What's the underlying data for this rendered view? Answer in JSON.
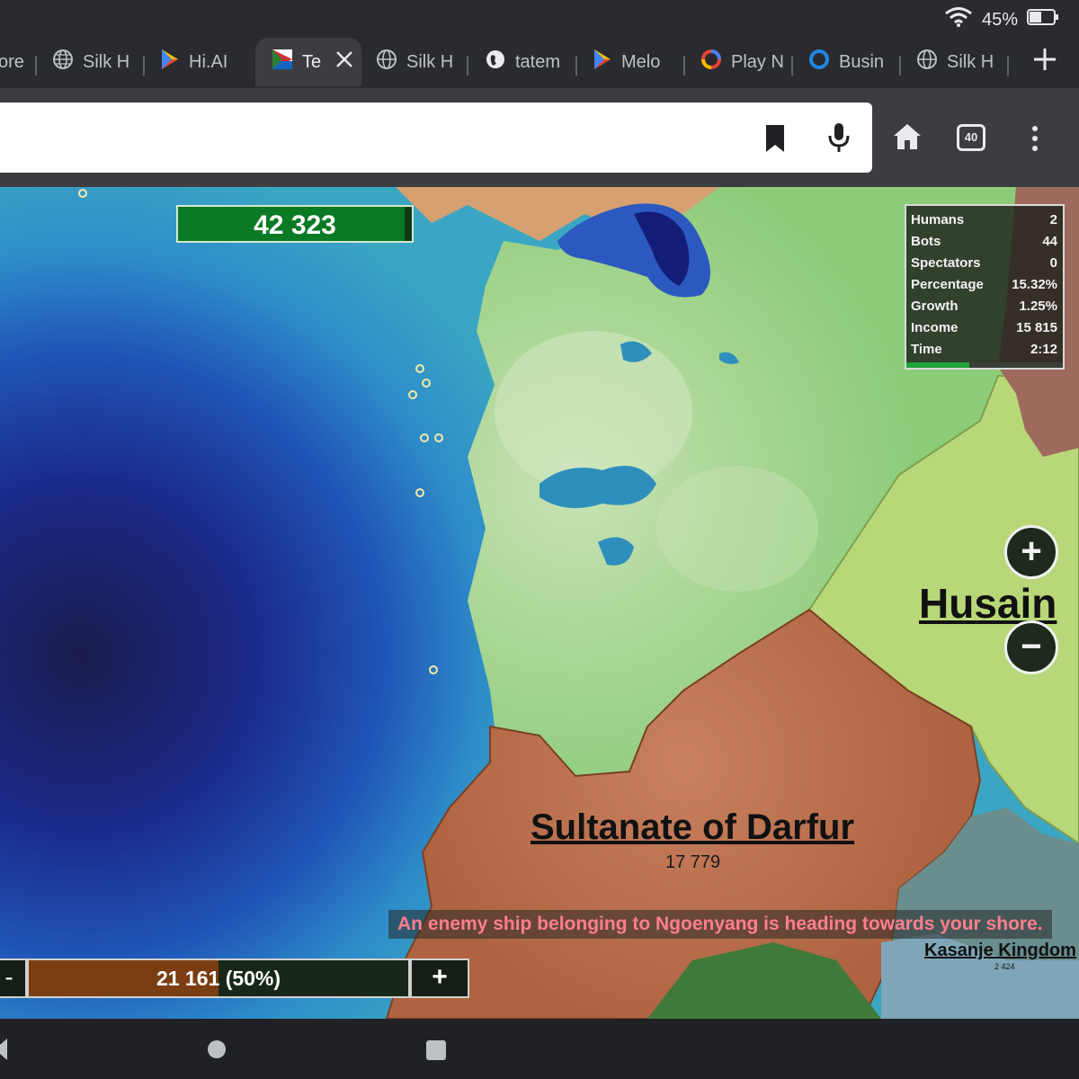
{
  "status": {
    "battery": "45%"
  },
  "tabs": [
    {
      "label": "ore",
      "icon": "globe-icon"
    },
    {
      "label": "Silk H",
      "icon": "globe-icon"
    },
    {
      "label": "Hi.AI",
      "icon": "play-store-icon"
    },
    {
      "label": "Te",
      "icon": "game-favicon",
      "active": true
    },
    {
      "label": "Silk H",
      "icon": "globe-icon"
    },
    {
      "label": "tatem",
      "icon": "globe-icon"
    },
    {
      "label": "Melo",
      "icon": "play-store-icon"
    },
    {
      "label": "Play N",
      "icon": "play-ring-icon"
    },
    {
      "label": "Busin",
      "icon": "ring-icon"
    },
    {
      "label": "Silk H",
      "icon": "globe-icon"
    }
  ],
  "toolbar": {
    "tab_count": "40"
  },
  "game": {
    "score": "42 323",
    "score_fill": 0.97,
    "stats": [
      {
        "label": "Humans",
        "value": "2"
      },
      {
        "label": "Bots",
        "value": "44"
      },
      {
        "label": "Spectators",
        "value": "0"
      },
      {
        "label": "Percentage",
        "value": "15.32%"
      },
      {
        "label": "Growth",
        "value": "1.25%"
      },
      {
        "label": "Income",
        "value": "15 815"
      },
      {
        "label": "Time",
        "value": "2:12"
      }
    ],
    "stats_progress": 0.4,
    "countries": [
      {
        "name": "Husain",
        "value": ""
      },
      {
        "name": "Sultanate of Darfur",
        "value": "17 779"
      },
      {
        "name": "Kasanje Kingdom",
        "value": "2 424"
      }
    ],
    "notification": "An enemy ship belonging to Ngoenyang is heading towards your shore.",
    "troops": {
      "value": "21 161",
      "percent": "(50%)",
      "fill": 0.5,
      "minus": "-",
      "plus": "+"
    },
    "zoom": {
      "in": "+",
      "out": "−"
    },
    "colors": {
      "player_territory": "#a5d48f",
      "husain": "#b8d778",
      "darfur": "#b86c45",
      "ocean_deep": "#1a1f5a",
      "ocean_shallow": "#3aa4c2",
      "score_bar": "#0b7a25"
    }
  }
}
